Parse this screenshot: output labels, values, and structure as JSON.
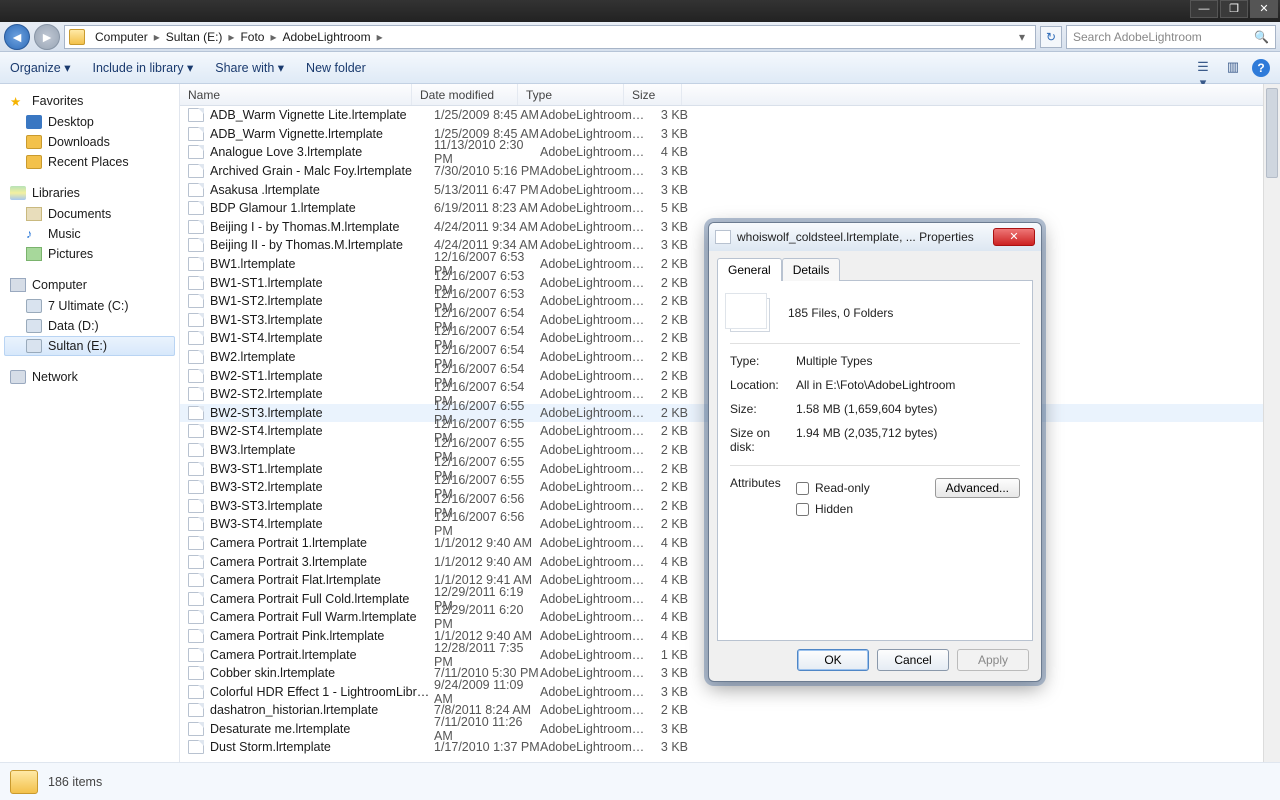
{
  "window_controls": {
    "min": "—",
    "max": "❐",
    "close": "✕"
  },
  "nav": {
    "back": "◄",
    "fwd": "►",
    "crumbs": [
      "Computer",
      "Sultan (E:)",
      "Foto",
      "AdobeLightroom"
    ],
    "refresh": "↻",
    "search_placeholder": "Search AdobeLightroom",
    "search_icon": "🔍"
  },
  "toolbar": {
    "organize": "Organize ▾",
    "include": "Include in library ▾",
    "share": "Share with ▾",
    "newfolder": "New folder",
    "help": "?"
  },
  "sidebar": {
    "favorites": "Favorites",
    "fav_items": [
      "Desktop",
      "Downloads",
      "Recent Places"
    ],
    "libraries": "Libraries",
    "lib_items": [
      "Documents",
      "Music",
      "Pictures"
    ],
    "computer": "Computer",
    "drives": [
      "7 Ultimate (C:)",
      "Data (D:)",
      "Sultan (E:)"
    ],
    "network": "Network"
  },
  "columns": {
    "name": "Name",
    "date": "Date modified",
    "type": "Type",
    "size": "Size"
  },
  "type_text": "AdobeLightroom.l...",
  "files": [
    {
      "n": "ADB_Warm Vignette Lite.lrtemplate",
      "d": "1/25/2009 8:45 AM",
      "s": "3 KB"
    },
    {
      "n": "ADB_Warm Vignette.lrtemplate",
      "d": "1/25/2009 8:45 AM",
      "s": "3 KB"
    },
    {
      "n": "Analogue Love 3.lrtemplate",
      "d": "11/13/2010 2:30 PM",
      "s": "4 KB"
    },
    {
      "n": "Archived Grain - Malc Foy.lrtemplate",
      "d": "7/30/2010 5:16 PM",
      "s": "3 KB"
    },
    {
      "n": "Asakusa .lrtemplate",
      "d": "5/13/2011 6:47 PM",
      "s": "3 KB"
    },
    {
      "n": "BDP Glamour 1.lrtemplate",
      "d": "6/19/2011 8:23 AM",
      "s": "5 KB"
    },
    {
      "n": "Beijing I - by Thomas.M.lrtemplate",
      "d": "4/24/2011 9:34 AM",
      "s": "3 KB"
    },
    {
      "n": "Beijing II - by Thomas.M.lrtemplate",
      "d": "4/24/2011 9:34 AM",
      "s": "3 KB"
    },
    {
      "n": "BW1.lrtemplate",
      "d": "12/16/2007 6:53 PM",
      "s": "2 KB"
    },
    {
      "n": "BW1-ST1.lrtemplate",
      "d": "12/16/2007 6:53 PM",
      "s": "2 KB"
    },
    {
      "n": "BW1-ST2.lrtemplate",
      "d": "12/16/2007 6:53 PM",
      "s": "2 KB"
    },
    {
      "n": "BW1-ST3.lrtemplate",
      "d": "12/16/2007 6:54 PM",
      "s": "2 KB"
    },
    {
      "n": "BW1-ST4.lrtemplate",
      "d": "12/16/2007 6:54 PM",
      "s": "2 KB"
    },
    {
      "n": "BW2.lrtemplate",
      "d": "12/16/2007 6:54 PM",
      "s": "2 KB"
    },
    {
      "n": "BW2-ST1.lrtemplate",
      "d": "12/16/2007 6:54 PM",
      "s": "2 KB"
    },
    {
      "n": "BW2-ST2.lrtemplate",
      "d": "12/16/2007 6:54 PM",
      "s": "2 KB"
    },
    {
      "n": "BW2-ST3.lrtemplate",
      "d": "12/16/2007 6:55 PM",
      "s": "2 KB",
      "hover": true
    },
    {
      "n": "BW2-ST4.lrtemplate",
      "d": "12/16/2007 6:55 PM",
      "s": "2 KB"
    },
    {
      "n": "BW3.lrtemplate",
      "d": "12/16/2007 6:55 PM",
      "s": "2 KB"
    },
    {
      "n": "BW3-ST1.lrtemplate",
      "d": "12/16/2007 6:55 PM",
      "s": "2 KB"
    },
    {
      "n": "BW3-ST2.lrtemplate",
      "d": "12/16/2007 6:55 PM",
      "s": "2 KB"
    },
    {
      "n": "BW3-ST3.lrtemplate",
      "d": "12/16/2007 6:56 PM",
      "s": "2 KB"
    },
    {
      "n": "BW3-ST4.lrtemplate",
      "d": "12/16/2007 6:56 PM",
      "s": "2 KB"
    },
    {
      "n": "Camera Portrait 1.lrtemplate",
      "d": "1/1/2012 9:40 AM",
      "s": "4 KB"
    },
    {
      "n": "Camera Portrait 3.lrtemplate",
      "d": "1/1/2012 9:40 AM",
      "s": "4 KB"
    },
    {
      "n": "Camera Portrait Flat.lrtemplate",
      "d": "1/1/2012 9:41 AM",
      "s": "4 KB"
    },
    {
      "n": "Camera Portrait Full Cold.lrtemplate",
      "d": "12/29/2011 6:19 PM",
      "s": "4 KB"
    },
    {
      "n": "Camera Portrait Full Warm.lrtemplate",
      "d": "12/29/2011 6:20 PM",
      "s": "4 KB"
    },
    {
      "n": "Camera Portrait Pink.lrtemplate",
      "d": "1/1/2012 9:40 AM",
      "s": "4 KB"
    },
    {
      "n": "Camera Portrait.lrtemplate",
      "d": "12/28/2011 7:35 PM",
      "s": "1 KB"
    },
    {
      "n": "Cobber skin.lrtemplate",
      "d": "7/11/2010 5:30 PM",
      "s": "3 KB"
    },
    {
      "n": "Colorful HDR Effect 1 - LightroomLibrary...",
      "d": "9/24/2009 11:09 AM",
      "s": "3 KB"
    },
    {
      "n": "dashatron_historian.lrtemplate",
      "d": "7/8/2011 8:24 AM",
      "s": "2 KB"
    },
    {
      "n": "Desaturate me.lrtemplate",
      "d": "7/11/2010 11:26 AM",
      "s": "3 KB"
    },
    {
      "n": "Dust Storm.lrtemplate",
      "d": "1/17/2010 1:37 PM",
      "s": "3 KB"
    }
  ],
  "status": {
    "count": "186 items"
  },
  "dialog": {
    "title": "whoiswolf_coldsteel.lrtemplate, ... Properties",
    "tabs": {
      "general": "General",
      "details": "Details"
    },
    "summary": "185 Files, 0 Folders",
    "labels": {
      "type": "Type:",
      "location": "Location:",
      "size": "Size:",
      "sizeondisk": "Size on disk:",
      "attributes": "Attributes"
    },
    "type": "Multiple Types",
    "location": "All in E:\\Foto\\AdobeLightroom",
    "size": "1.58 MB (1,659,604 bytes)",
    "sizeondisk": "1.94 MB (2,035,712 bytes)",
    "attr_readonly": "Read-only",
    "attr_hidden": "Hidden",
    "advanced": "Advanced...",
    "ok": "OK",
    "cancel": "Cancel",
    "apply": "Apply"
  }
}
